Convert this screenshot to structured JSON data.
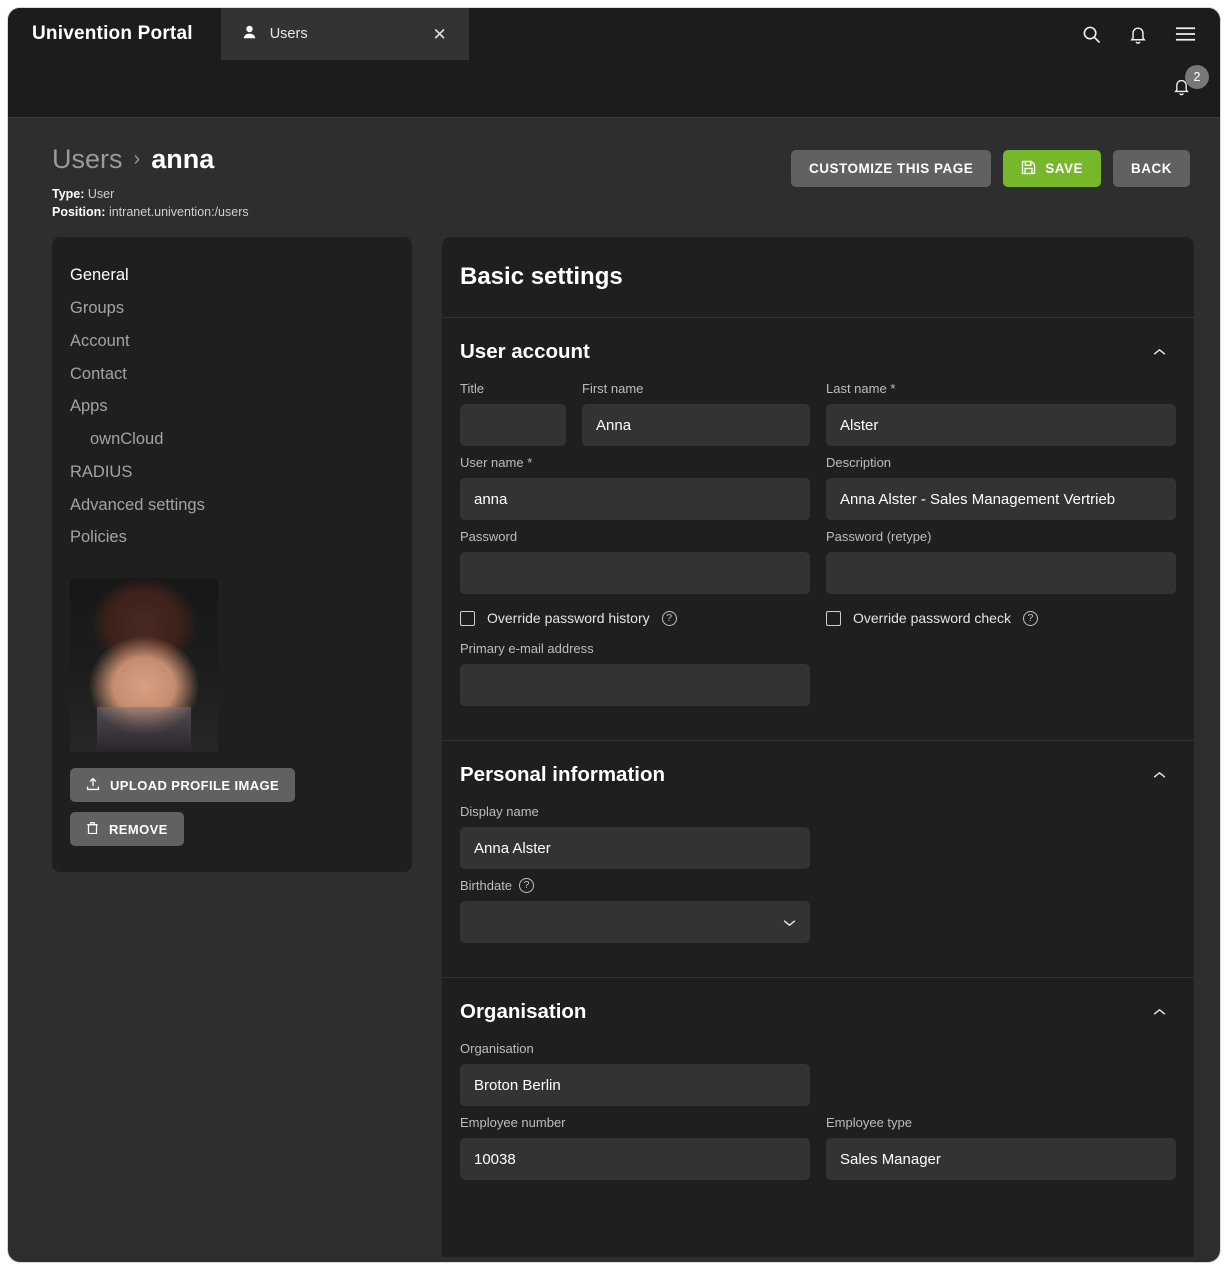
{
  "topbar": {
    "brand": "Univention Portal",
    "tab": {
      "label": "Users",
      "icon": "user-icon",
      "close": "✕"
    },
    "icons": {
      "search": "search-icon",
      "bell": "bell-icon",
      "menu": "hamburger-menu-icon"
    }
  },
  "notifications": {
    "count": "2",
    "icon": "bell-icon"
  },
  "header": {
    "breadcrumb_parent": "Users",
    "breadcrumb_sep": "›",
    "breadcrumb_current": "anna",
    "type_label": "Type:",
    "type_value": "User",
    "position_label": "Position:",
    "position_value": "intranet.univention:/users",
    "customize_label": "CUSTOMIZE THIS PAGE",
    "save_label": "SAVE",
    "save_icon": "save-floppy-icon",
    "back_label": "BACK",
    "accent_green": "#76b82a",
    "button_grey": "#616161"
  },
  "sidebar": {
    "items": [
      {
        "label": "General",
        "active": true,
        "sub": false
      },
      {
        "label": "Groups",
        "active": false,
        "sub": false
      },
      {
        "label": "Account",
        "active": false,
        "sub": false
      },
      {
        "label": "Contact",
        "active": false,
        "sub": false
      },
      {
        "label": "Apps",
        "active": false,
        "sub": false
      },
      {
        "label": "ownCloud",
        "active": false,
        "sub": true
      },
      {
        "label": "RADIUS",
        "active": false,
        "sub": false
      },
      {
        "label": "Advanced settings",
        "active": false,
        "sub": false
      },
      {
        "label": "Policies",
        "active": false,
        "sub": false
      }
    ],
    "upload_label": "UPLOAD PROFILE IMAGE",
    "upload_icon": "upload-icon",
    "remove_label": "REMOVE",
    "remove_icon": "trash-icon",
    "avatar_alt": "profile-photo"
  },
  "panel": {
    "title": "Basic settings",
    "sections": [
      {
        "title": "User account",
        "collapse_icon": "chevron-up-icon",
        "fields": {
          "title": {
            "label": "Title",
            "value": ""
          },
          "first_name": {
            "label": "First name",
            "value": "Anna"
          },
          "last_name": {
            "label": "Last name *",
            "value": "Alster"
          },
          "user_name": {
            "label": "User name *",
            "value": "anna"
          },
          "description": {
            "label": "Description",
            "value": "Anna Alster - Sales Management Vertrieb"
          },
          "password": {
            "label": "Password",
            "value": ""
          },
          "password_retype": {
            "label": "Password (retype)",
            "value": ""
          },
          "primary_email": {
            "label": "Primary e-mail address",
            "value": ""
          }
        },
        "checkboxes": [
          {
            "label": "Override password history",
            "checked": false,
            "help": "?"
          },
          {
            "label": "Override password check",
            "checked": false,
            "help": "?"
          }
        ]
      },
      {
        "title": "Personal information",
        "collapse_icon": "chevron-up-icon",
        "fields": {
          "display_name": {
            "label": "Display name",
            "value": "Anna Alster"
          },
          "birthdate": {
            "label": "Birthdate",
            "value": "",
            "help": "?",
            "dropdown_icon": "chevron-down-icon"
          }
        }
      },
      {
        "title": "Organisation",
        "collapse_icon": "chevron-up-icon",
        "fields": {
          "organisation": {
            "label": "Organisation",
            "value": "Broton Berlin"
          },
          "employee_number": {
            "label": "Employee number",
            "value": "10038"
          },
          "employee_type": {
            "label": "Employee type",
            "value": "Sales Manager"
          }
        }
      }
    ]
  }
}
